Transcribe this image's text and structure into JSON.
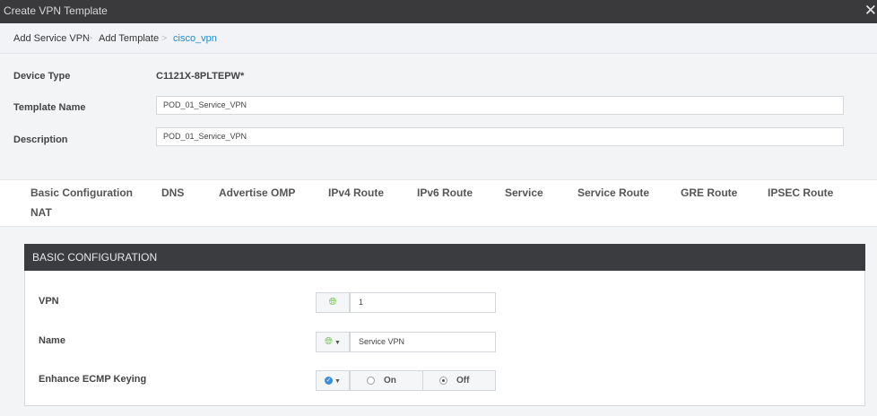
{
  "window": {
    "title": "Create VPN Template",
    "close_glyph": "✕"
  },
  "breadcrumb": {
    "items": [
      "Add Service VPN",
      "Add Template",
      "cisco_vpn"
    ],
    "separator": ">"
  },
  "form": {
    "device_type_label": "Device Type",
    "device_type_value": "C1121X-8PLTEPW*",
    "template_name_label": "Template Name",
    "template_name_value": "POD_01_Service_VPN",
    "description_label": "Description",
    "description_value": "POD_01_Service_VPN"
  },
  "tabs": [
    "Basic Configuration",
    "DNS",
    "Advertise OMP",
    "IPv4 Route",
    "IPv6 Route",
    "Service",
    "Service Route",
    "GRE Route",
    "IPSEC Route",
    "NAT"
  ],
  "panel": {
    "title": "BASIC CONFIGURATION",
    "vpn": {
      "label": "VPN",
      "value": "1",
      "scope_icon": "globe-icon"
    },
    "name": {
      "label": "Name",
      "value": "Service VPN",
      "scope_icon": "globe-icon"
    },
    "ecmp": {
      "label": "Enhance ECMP Keying",
      "scope_icon": "check-circle-icon",
      "options": [
        "On",
        "Off"
      ],
      "selected": "Off"
    }
  },
  "colors": {
    "titlebar": "#3a3a3d",
    "panel_header": "#3b3c3f",
    "link": "#1a8bd6",
    "globe": "#6abe45",
    "check": "#3d8ed6"
  }
}
